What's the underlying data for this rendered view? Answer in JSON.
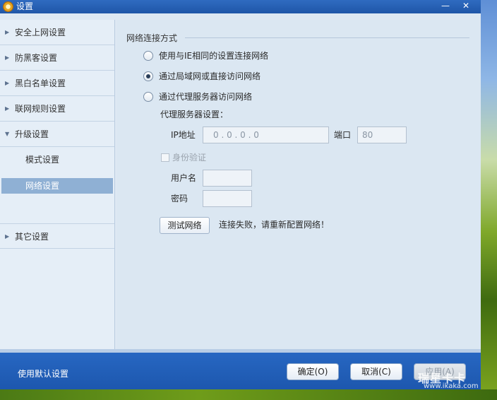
{
  "window": {
    "title": "设置",
    "minimize_glyph": "—",
    "close_glyph": "✕"
  },
  "sidebar": {
    "items": [
      {
        "label": "安全上网设置",
        "arrow": "▶"
      },
      {
        "label": "防黑客设置",
        "arrow": "▶"
      },
      {
        "label": "黑白名单设置",
        "arrow": "▶"
      },
      {
        "label": "联网规则设置",
        "arrow": "▶"
      },
      {
        "label": "升级设置",
        "arrow": "▼",
        "expanded": true
      }
    ],
    "subitems": [
      {
        "label": "模式设置",
        "selected": false
      },
      {
        "label": "网络设置",
        "selected": true
      }
    ],
    "last_item": {
      "label": "其它设置",
      "arrow": "▶"
    }
  },
  "main": {
    "group_title": "网络连接方式",
    "options": [
      {
        "label": "使用与IE相同的设置连接网络",
        "checked": false
      },
      {
        "label": "通过局域网或直接访问网络",
        "checked": true
      },
      {
        "label": "通过代理服务器访问网络",
        "checked": false
      }
    ],
    "proxy": {
      "section_label": "代理服务器设置：",
      "ip_label": "IP地址",
      "ip_value": "0  .  0  .  0  .  0",
      "port_label": "端口",
      "port_value": "80",
      "auth_label": "身份验证",
      "auth_checked": false,
      "username_label": "用户名",
      "username_value": "",
      "password_label": "密码",
      "password_value": ""
    },
    "test_button": "测试网络",
    "status_text": "连接失败，请重新配置网络！"
  },
  "footer": {
    "default_link": "使用默认设置",
    "ok_button": "确定(O)",
    "cancel_button": "取消(C)",
    "apply_button": "应用(A)"
  },
  "watermark": {
    "logo": "瑞星卡卡",
    "url": "www.ikaka.com"
  },
  "colors": {
    "titlebar": "#1f56a8",
    "sidebar_selected": "#8fb0d4",
    "content_bg": "#dbe7f2"
  },
  "icons": {
    "title_icon": "gear-icon",
    "expand_arrow": "chevron-right-icon",
    "collapse_arrow": "chevron-down-icon"
  }
}
